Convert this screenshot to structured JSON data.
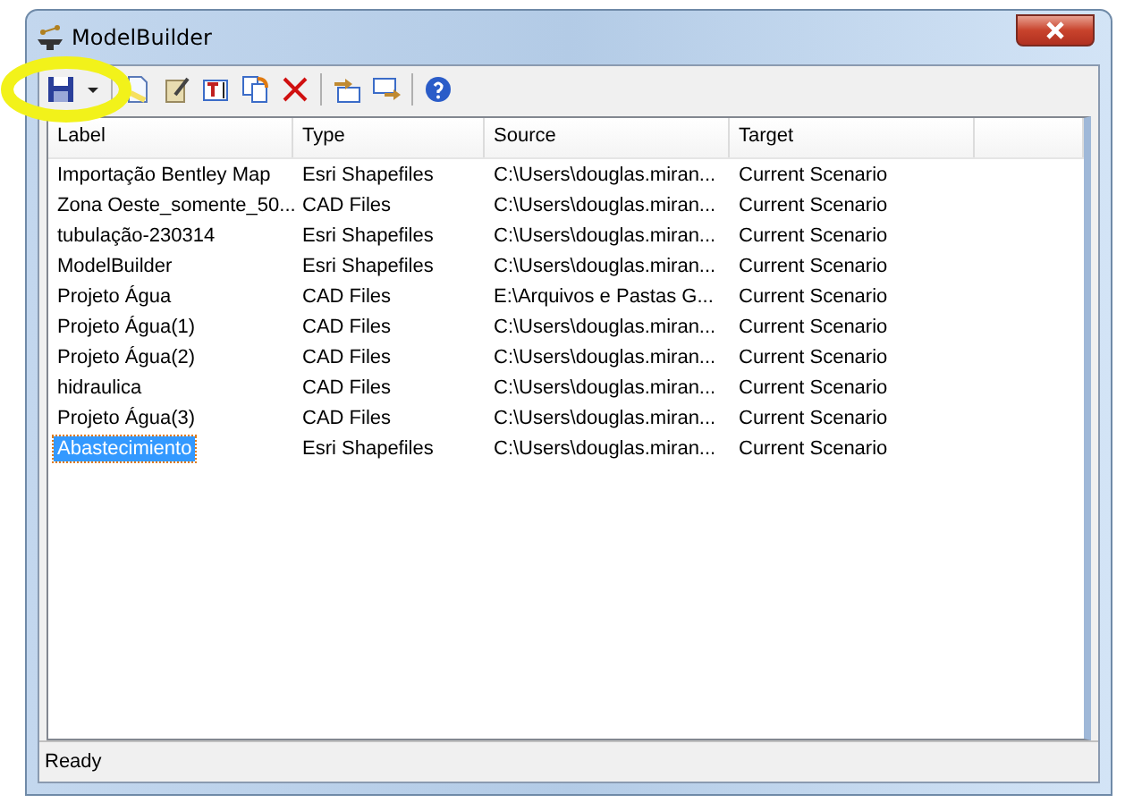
{
  "window": {
    "title": "ModelBuilder"
  },
  "table": {
    "columns": [
      "Label",
      "Type",
      "Source",
      "Target"
    ],
    "rows": [
      {
        "label": "Importação Bentley Map",
        "type": "Esri Shapefiles",
        "source": "C:\\Users\\douglas.miran...",
        "target": "Current Scenario",
        "selected": false
      },
      {
        "label": "Zona Oeste_somente_50...",
        "type": "CAD Files",
        "source": "C:\\Users\\douglas.miran...",
        "target": "Current Scenario",
        "selected": false
      },
      {
        "label": "tubulação-230314",
        "type": "Esri Shapefiles",
        "source": "C:\\Users\\douglas.miran...",
        "target": "Current Scenario",
        "selected": false
      },
      {
        "label": "ModelBuilder",
        "type": "Esri Shapefiles",
        "source": "C:\\Users\\douglas.miran...",
        "target": "Current Scenario",
        "selected": false
      },
      {
        "label": "Projeto Água",
        "type": "CAD Files",
        "source": "E:\\Arquivos e Pastas G...",
        "target": "Current Scenario",
        "selected": false
      },
      {
        "label": "Projeto Água(1)",
        "type": "CAD Files",
        "source": "C:\\Users\\douglas.miran...",
        "target": "Current Scenario",
        "selected": false
      },
      {
        "label": "Projeto Água(2)",
        "type": "CAD Files",
        "source": "C:\\Users\\douglas.miran...",
        "target": "Current Scenario",
        "selected": false
      },
      {
        "label": "hidraulica",
        "type": "CAD Files",
        "source": "C:\\Users\\douglas.miran...",
        "target": "Current Scenario",
        "selected": false
      },
      {
        "label": "Projeto Água(3)",
        "type": "CAD Files",
        "source": "C:\\Users\\douglas.miran...",
        "target": "Current Scenario",
        "selected": false
      },
      {
        "label": "Abastecimiento",
        "type": "Esri Shapefiles",
        "source": "C:\\Users\\douglas.miran...",
        "target": "Current Scenario",
        "selected": true
      }
    ]
  },
  "status_bar": "Ready"
}
